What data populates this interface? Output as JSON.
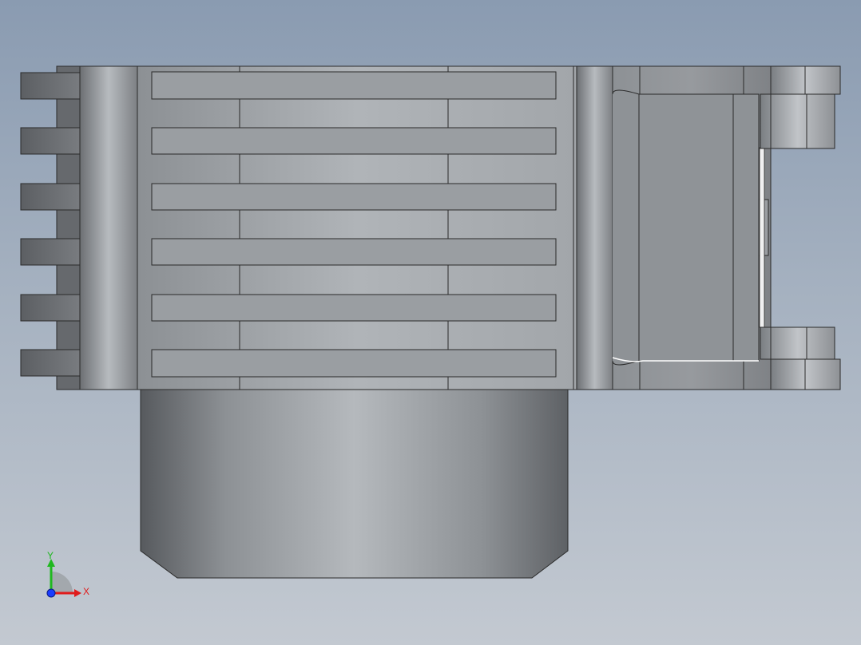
{
  "viewport": {
    "background_top": "#8a9bb1",
    "background_bottom": "#c3c9d1",
    "edge_color": "#2a2a2a"
  },
  "model": {
    "view": "top",
    "part_color": "#a9adb1",
    "fin_count": 6
  },
  "triad": {
    "y_label": "Y",
    "x_label": "X",
    "y_color": "#1fb81f",
    "x_color": "#e01b1b",
    "z_color": "#1a3cff"
  }
}
